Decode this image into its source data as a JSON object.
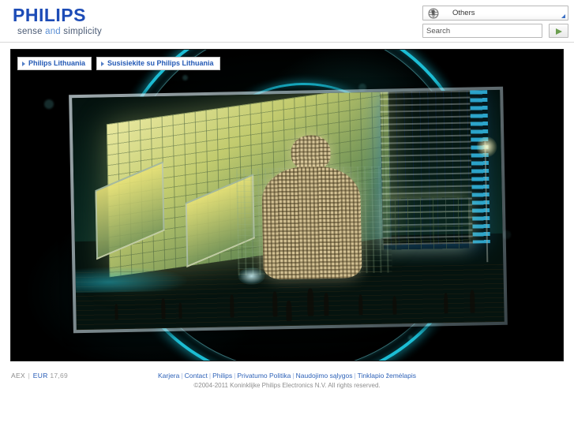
{
  "header": {
    "logo": {
      "wordmark": "PHILIPS",
      "tagline_part1": "sense ",
      "tagline_and": "and",
      "tagline_part2": " simplicity",
      "brand_color": "#1c4bb6"
    },
    "country_selector": {
      "icon": "globe-icon",
      "selected_value": "Others",
      "caret_icon": "corner-resize-icon"
    },
    "search": {
      "placeholder": "Search",
      "value": "",
      "submit_icon": "play-arrow-icon",
      "submit_label": ""
    }
  },
  "hero": {
    "tabs": [
      {
        "label": "Philips Lithuania",
        "bullet_icon": "arrow-right-icon"
      },
      {
        "label": "Susisiekite su Philips Lithuania",
        "bullet_icon": "arrow-right-icon"
      }
    ],
    "image_alt": "Night plaza with illuminated glass building, lattice human sculpture and blue LED tower",
    "accent_color": "#1ec8e0",
    "background_color": "#000000"
  },
  "footer": {
    "stock": {
      "index": "AEX",
      "separator": "|",
      "currency_link": "EUR",
      "value": "17,69"
    },
    "links": [
      "Karjera",
      "Contact",
      "Philips",
      "Privatumo Politika",
      "Naudojimo sąlygos",
      "Tinklapio žemėlapis"
    ],
    "link_separator": "|",
    "copyright": "©2004-2011 Koninklijke Philips Electronics N.V. All rights reserved."
  }
}
